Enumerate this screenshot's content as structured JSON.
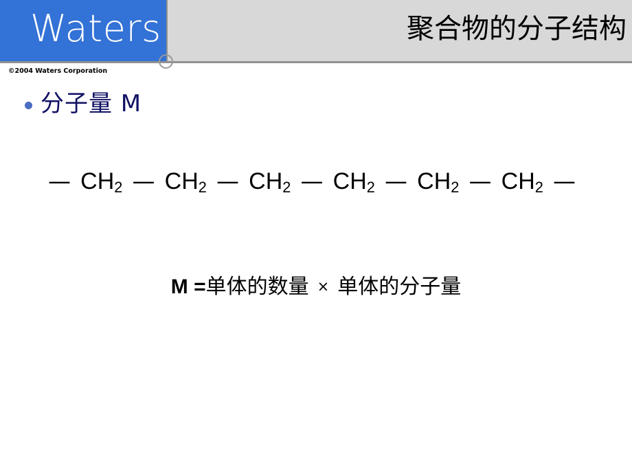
{
  "header": {
    "logo_text": "Waters",
    "title": "聚合物的分子结构",
    "copyright": "©2004 Waters Corporation"
  },
  "colors": {
    "logo_blue": "#3372d6",
    "header_gray": "#d8d8d8",
    "rule_gray": "#909090",
    "bullet_blue": "#4b6dc4",
    "heading_navy": "#101063",
    "body_black": "#000000"
  },
  "content": {
    "bullet": {
      "marker": "bullet-dot",
      "label": "分子量  M"
    },
    "chain": {
      "bond": "—",
      "unit_prefix": "CH",
      "unit_subscript": "2",
      "unit_count": 6,
      "full_text": "— CH2 — CH2 — CH2 — CH2 — CH2 — CH2 —"
    },
    "formula": {
      "lhs": "M =",
      "term_one": "单体的数量",
      "operator": "×",
      "term_two": "单体的分子量",
      "full_text": "M = 单体的数量 × 单体的分子量"
    }
  }
}
